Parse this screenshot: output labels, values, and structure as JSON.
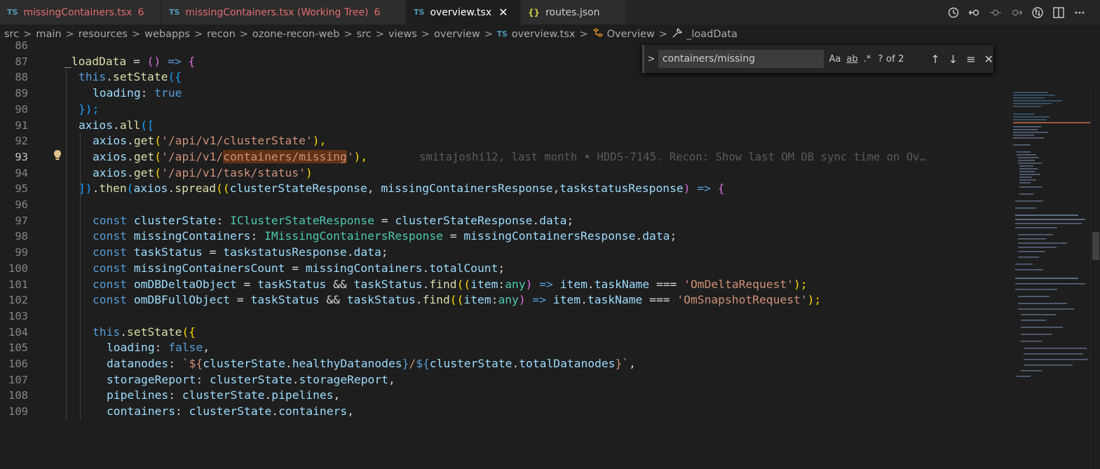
{
  "tabs": [
    {
      "icon": "TS",
      "label": "missingContainers.tsx",
      "badge": "6"
    },
    {
      "icon": "TS",
      "label": "missingContainers.tsx (Working Tree)",
      "badge": "6"
    },
    {
      "icon": "TS",
      "label": "overview.tsx",
      "close": "✕"
    },
    {
      "icon": "{}",
      "label": "routes.json"
    }
  ],
  "actions": [
    "history-icon",
    "go-back-icon",
    "circle-icon",
    "go-forward-icon",
    "git-compare-icon",
    "split-editor-icon",
    "more-icon"
  ],
  "breadcrumb": [
    "src",
    "main",
    "resources",
    "webapps",
    "recon",
    "ozone-recon-web",
    "src",
    "views",
    "overview",
    "overview.tsx",
    "Overview",
    "_loadData"
  ],
  "breadcrumb_ts": "TS",
  "find": {
    "query": "containers/missing",
    "match_case": "Aa",
    "whole_word": "ab",
    "regex": ".*",
    "count": "? of 2"
  },
  "line_numbers": [
    "86",
    "87",
    "88",
    "89",
    "90",
    "91",
    "92",
    "93",
    "94",
    "95",
    "96",
    "97",
    "98",
    "99",
    "100",
    "101",
    "102",
    "103",
    "104",
    "105",
    "106",
    "107",
    "108",
    "109"
  ],
  "current_line": "93",
  "blame": "smitajoshi12, last month • HDDS-7145. Recon: Show last OM DB sync time on Ov…",
  "code": {
    "l87": {
      "a": "_loadData",
      "b": " = ",
      "c": "()",
      "d": " => ",
      "e": "{"
    },
    "l88": {
      "a": "this",
      "b": ".",
      "c": "setState",
      "d": "({"
    },
    "l89": {
      "a": "loading",
      "b": ": ",
      "c": "true"
    },
    "l90": {
      "a": "});"
    },
    "l91": {
      "a": "axios",
      "b": ".",
      "c": "all",
      "d": "(["
    },
    "l92": {
      "a": "axios",
      "b": ".",
      "c": "get",
      "d": "(",
      "e": "'/api/v1/clusterState'",
      "f": "),"
    },
    "l93": {
      "a": "axios",
      "b": ".",
      "c": "get",
      "d": "(",
      "e": "'/api/v1/",
      "f": "containers/missing",
      "g": "'",
      "h": "),"
    },
    "l94": {
      "a": "axios",
      "b": ".",
      "c": "get",
      "d": "(",
      "e": "'/api/v1/task/status'",
      "f": ")"
    },
    "l95": {
      "a": "])",
      "b": ".",
      "c": "then",
      "d": "(",
      "e": "axios",
      "f": ".",
      "g": "spread",
      "h": "((",
      "i": "clusterStateResponse",
      "j": ", ",
      "k": "missingContainersResponse",
      "l": ",",
      "m": "taskstatusResponse",
      "n": ")",
      "o": " => ",
      "p": "{"
    },
    "l97": {
      "a": "const",
      "b": " clusterState",
      "c": ": ",
      "d": "IClusterStateResponse",
      "e": " = ",
      "f": "clusterStateResponse",
      "g": ".",
      "h": "data",
      "i": ";"
    },
    "l98": {
      "a": "const",
      "b": " missingContainers",
      "c": ": ",
      "d": "IMissingContainersResponse",
      "e": " = ",
      "f": "missingContainersResponse",
      "g": ".",
      "h": "data",
      "i": ";"
    },
    "l99": {
      "a": "const",
      "b": " taskStatus",
      "c": " = ",
      "d": "taskstatusResponse",
      "e": ".",
      "f": "data",
      "g": ";"
    },
    "l100": {
      "a": "const",
      "b": " missingContainersCount",
      "c": " = ",
      "d": "missingContainers",
      "e": ".",
      "f": "totalCount",
      "g": ";"
    },
    "l101": {
      "a": "const",
      "b": " omDBDeltaObject",
      "c": " = ",
      "d": "taskStatus",
      "e": " && ",
      "f": "taskStatus",
      "g": ".",
      "h": "find",
      "i": "((",
      "j": "item",
      "k": ":",
      "l": "any",
      "m": ")",
      "n": " => ",
      "o": "item",
      "p": ".",
      "q": "taskName",
      "r": " === ",
      "s": "'OmDeltaRequest'",
      "t": ");"
    },
    "l102": {
      "a": "const",
      "b": " omDBFullObject",
      "c": " = ",
      "d": "taskStatus",
      "e": " && ",
      "f": "taskStatus",
      "g": ".",
      "h": "find",
      "i": "((",
      "j": "item",
      "k": ":",
      "l": "any",
      "m": ")",
      "n": " => ",
      "o": "item",
      "p": ".",
      "q": "taskName",
      "r": " === ",
      "s": "'OmSnapshotRequest'",
      "t": ");"
    },
    "l104": {
      "a": "this",
      "b": ".",
      "c": "setState",
      "d": "({"
    },
    "l105": {
      "a": "loading",
      "b": ": ",
      "c": "false",
      "d": ","
    },
    "l106": {
      "a": "datanodes",
      "b": ": ",
      "c": "`${",
      "d": "clusterState",
      "e": ".",
      "f": "healthyDatanodes",
      "g": "}",
      "h": "/",
      "i": "${",
      "j": "clusterState",
      "k": ".",
      "l": "totalDatanodes",
      "m": "}`",
      "n": ","
    },
    "l107": {
      "a": "storageReport",
      "b": ": ",
      "c": "clusterState",
      "d": ".",
      "e": "storageReport",
      "f": ","
    },
    "l108": {
      "a": "pipelines",
      "b": ": ",
      "c": "clusterState",
      "d": ".",
      "e": "pipelines",
      "f": ","
    },
    "l109": {
      "a": "containers",
      "b": ": ",
      "c": "clusterState",
      "d": ".",
      "e": "containers",
      "f": ","
    }
  },
  "colors": {
    "background": "#1e1e1e",
    "keyword": "#569cd6",
    "function": "#dcdcaa",
    "variable": "#9cdcfe",
    "string": "#ce9178",
    "type": "#4ec9b0",
    "modified_tab": "#e06c6c",
    "match_highlight": "#613214"
  }
}
